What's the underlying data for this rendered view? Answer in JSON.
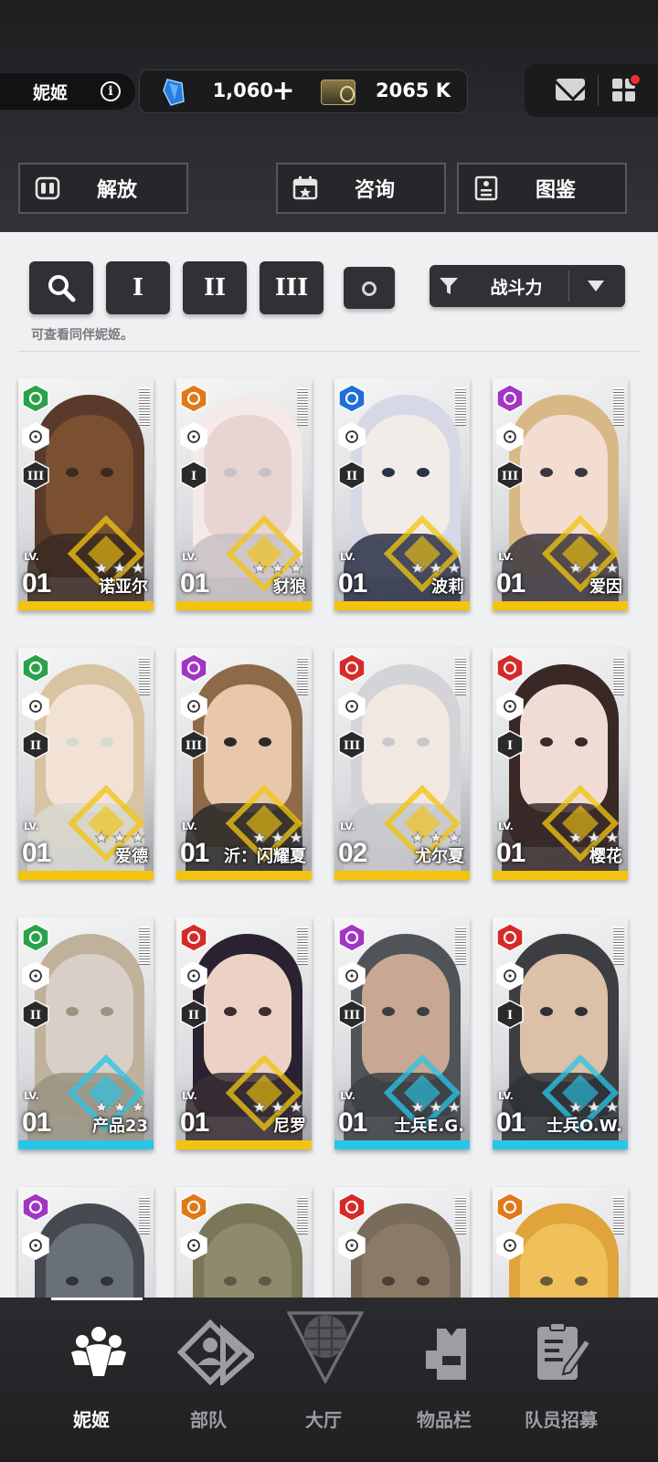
{
  "header": {
    "name_label": "妮姬",
    "info_icon": "info-icon",
    "gems": "1,060",
    "plus": "+",
    "credits": "2065 K"
  },
  "top_buttons": [
    {
      "label": "解放",
      "icon": "unlock-icon"
    },
    {
      "label": "咨询",
      "icon": "calendar-icon"
    },
    {
      "label": "图鉴",
      "icon": "codex-icon"
    }
  ],
  "filters": {
    "class_1": "I",
    "class_2": "II",
    "class_3": "III",
    "sort_label": "战斗力",
    "hint": "可查看同伴妮姬。"
  },
  "cards": [
    {
      "name": "诺亚尔",
      "lv_label": "LV.",
      "level": "01",
      "class": "III",
      "element": "wind",
      "element_color": "#2aa14a",
      "bar": "#f2c40f"
    },
    {
      "name": "豺狼",
      "lv_label": "LV.",
      "level": "01",
      "class": "I",
      "element": "iron",
      "element_color": "#e07a18",
      "bar": "#f2c40f"
    },
    {
      "name": "波莉",
      "lv_label": "LV.",
      "level": "01",
      "class": "II",
      "element": "water",
      "element_color": "#1f6fd6",
      "bar": "#f2c40f"
    },
    {
      "name": "爱因",
      "lv_label": "LV.",
      "level": "01",
      "class": "III",
      "element": "electric",
      "element_color": "#a236c4",
      "bar": "#f2c40f"
    },
    {
      "name": "爱德",
      "lv_label": "LV.",
      "level": "01",
      "class": "II",
      "element": "wind",
      "element_color": "#2aa14a",
      "bar": "#f2c40f"
    },
    {
      "name": "沂：闪耀夏",
      "lv_label": "LV.",
      "level": "01",
      "class": "III",
      "element": "electric",
      "element_color": "#a236c4",
      "bar": "#f2c40f"
    },
    {
      "name": "尤尔夏",
      "lv_label": "LV.",
      "level": "02",
      "class": "III",
      "element": "fire",
      "element_color": "#d62a2a",
      "bar": "#f2c40f"
    },
    {
      "name": "樱花",
      "lv_label": "LV.",
      "level": "01",
      "class": "I",
      "element": "fire",
      "element_color": "#d62a2a",
      "bar": "#f2c40f"
    },
    {
      "name": "产品23",
      "lv_label": "LV.",
      "level": "01",
      "class": "II",
      "element": "wind",
      "element_color": "#2aa14a",
      "bar": "#27c6e8"
    },
    {
      "name": "尼罗",
      "lv_label": "LV.",
      "level": "01",
      "class": "II",
      "element": "fire",
      "element_color": "#d62a2a",
      "bar": "#f2c40f"
    },
    {
      "name": "士兵E.G.",
      "lv_label": "LV.",
      "level": "01",
      "class": "III",
      "element": "electric",
      "element_color": "#a236c4",
      "bar": "#27c6e8"
    },
    {
      "name": "士兵O.W.",
      "lv_label": "LV.",
      "level": "01",
      "class": "I",
      "element": "fire",
      "element_color": "#d62a2a",
      "bar": "#27c6e8"
    },
    {
      "name": "",
      "lv_label": "",
      "level": "",
      "class": "",
      "element": "electric",
      "element_color": "#a236c4",
      "bar": "#27c6e8"
    },
    {
      "name": "",
      "lv_label": "",
      "level": "",
      "class": "",
      "element": "iron",
      "element_color": "#e07a18",
      "bar": "#27c6e8"
    },
    {
      "name": "",
      "lv_label": "",
      "level": "",
      "class": "",
      "element": "fire",
      "element_color": "#d62a2a",
      "bar": "#27c6e8"
    },
    {
      "name": "",
      "lv_label": "",
      "level": "",
      "class": "",
      "element": "iron",
      "element_color": "#e07a18",
      "bar": "#27c6e8"
    }
  ],
  "nav": [
    {
      "label": "妮姬",
      "icon": "nikke-icon",
      "active": true
    },
    {
      "label": "部队",
      "icon": "squad-icon",
      "active": false
    },
    {
      "label": "大厅",
      "icon": "lobby-icon",
      "active": false
    },
    {
      "label": "物品栏",
      "icon": "inventory-icon",
      "active": false
    },
    {
      "label": "队员招募",
      "icon": "recruit-icon",
      "active": false
    }
  ]
}
